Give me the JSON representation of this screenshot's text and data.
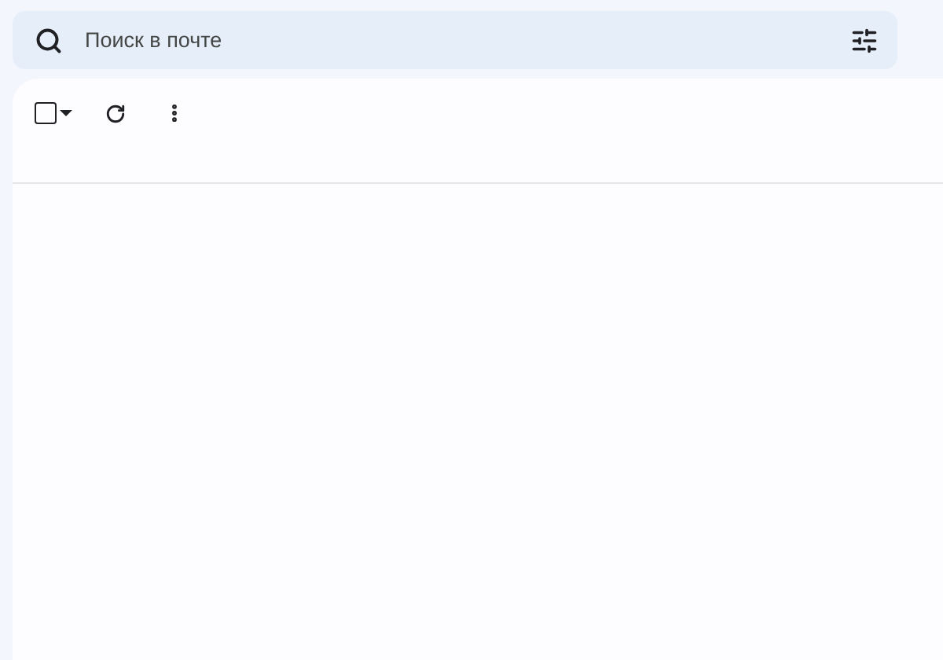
{
  "search": {
    "placeholder": "Поиск в почте"
  },
  "toolbar": {
    "select_all": {
      "checked": false
    }
  }
}
